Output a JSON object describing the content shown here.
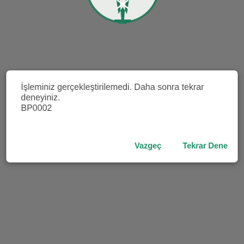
{
  "background": {
    "logo_icon": "bank-tree-logo-icon",
    "logo_color": "#1f7a5c"
  },
  "dialog": {
    "message_lines": [
      "İşleminiz gerçekleştirilemedi. Daha sonra tekrar",
      "deneyiniz.",
      "BP0002"
    ],
    "cancel_label": "Vazgeç",
    "retry_label": "Tekrar Dene",
    "accent_color": "#1f8f69"
  }
}
